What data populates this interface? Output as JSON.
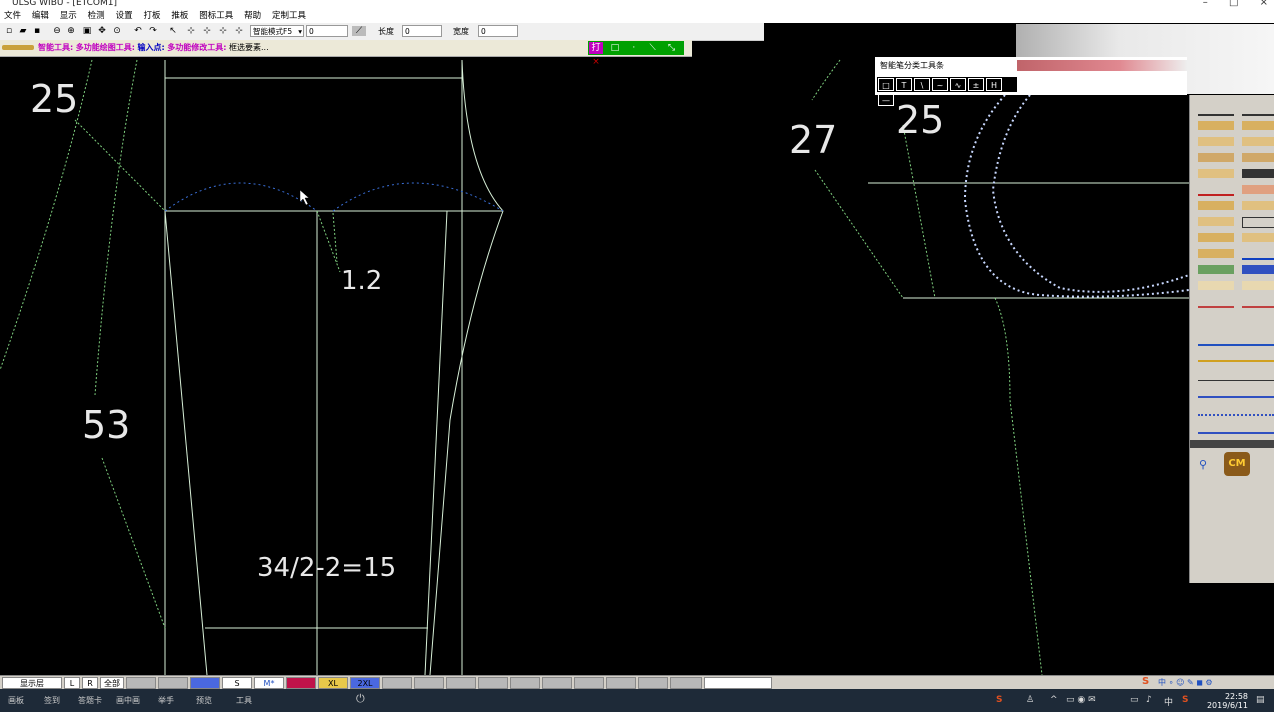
{
  "window": {
    "title": "ULSG WIBU - [ETCOM1]",
    "controls": [
      "–",
      "□",
      "×"
    ]
  },
  "menu": [
    "文件",
    "编辑",
    "显示",
    "检测",
    "设置",
    "打板",
    "推板",
    "图标工具",
    "帮助",
    "定制工具"
  ],
  "toolbar": {
    "mode_select": "智能模式F5",
    "value_field": "0",
    "length_label": "长度",
    "length_value": "0",
    "width_label": "宽度",
    "width_value": "0"
  },
  "hintbar": {
    "tool1": "智能工具:",
    "tool1_desc": "多功能绘图工具:",
    "point_in": "输入点:",
    "tool2_desc": "多功能修改工具:",
    "select": "框选要素..."
  },
  "greenbar": {
    "first": "打"
  },
  "smart_toolbar": {
    "title": "智能笔分类工具条",
    "icons": [
      "□",
      "T",
      "\\",
      "~",
      "∿",
      "±",
      "H",
      "—"
    ]
  },
  "canvas_labels": {
    "left_25": "25",
    "left_53": "53",
    "val_12": "1.2",
    "formula": "34/2-2=15",
    "right_27": "27",
    "right_25": "25"
  },
  "right_panel": {
    "cm_label": "CM"
  },
  "status": {
    "layer": "显示层",
    "l": "L",
    "r": "R",
    "all": "全部",
    "sizes": [
      "S",
      "M*",
      "L",
      "XL",
      "2XL"
    ],
    "size_colors": [
      "#ffffff",
      "#ffffff",
      "#c0134a",
      "#e8c84a",
      "#4a68e0"
    ]
  },
  "taskbar": {
    "items": [
      "画板",
      "签到",
      "答题卡",
      "画中画",
      "举手",
      "预览",
      "工具"
    ],
    "time": "22:58",
    "date": "2019/6/11",
    "ime": "中"
  }
}
